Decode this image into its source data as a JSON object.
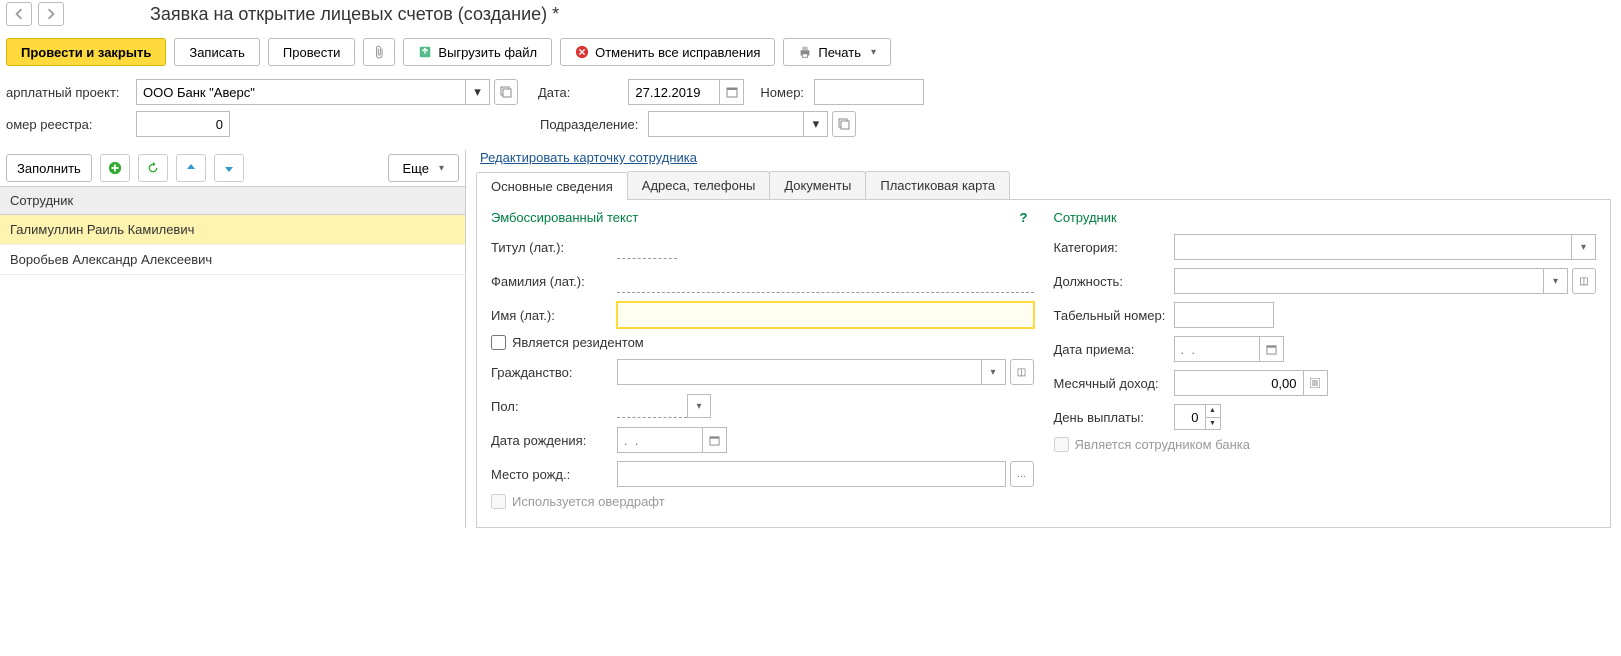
{
  "page_title": "Заявка на открытие лицевых счетов (создание) *",
  "toolbar": {
    "post_close": "Провести и закрыть",
    "save": "Записать",
    "post": "Провести",
    "upload": "Выгрузить файл",
    "cancel_fixes": "Отменить все исправления",
    "print": "Печать"
  },
  "header": {
    "project_label": "арплатный проект:",
    "project_value": "ООО Банк \"Аверс\"",
    "date_label": "Дата:",
    "date_value": "27.12.2019",
    "number_label": "Номер:",
    "number_value": "",
    "registry_label": "омер реестра:",
    "registry_value": "0",
    "dept_label": "Подразделение:",
    "dept_value": ""
  },
  "left": {
    "fill": "Заполнить",
    "more": "Еще",
    "col_header": "Сотрудник",
    "rows": [
      {
        "name": "Галимуллин Раиль Камилевич"
      },
      {
        "name": "Воробьев Александр Алексеевич"
      }
    ]
  },
  "right": {
    "edit_link": "Редактировать карточку сотрудника",
    "tabs": [
      {
        "label": "Основные сведения"
      },
      {
        "label": "Адреса, телефоны"
      },
      {
        "label": "Документы"
      },
      {
        "label": "Пластиковая карта"
      }
    ],
    "left_col": {
      "section": "Эмбоссированный текст",
      "title_label": "Титул (лат.):",
      "surname_label": "Фамилия (лат.):",
      "name_label": "Имя (лат.):",
      "resident_label": "Является резидентом",
      "citizenship_label": "Гражданство:",
      "gender_label": "Пол:",
      "birthdate_label": "Дата рождения:",
      "birthdate_placeholder": ".  .",
      "birthplace_label": "Место рожд.:",
      "overdraft_label": "Используется овердрафт"
    },
    "right_col": {
      "section": "Сотрудник",
      "category_label": "Категория:",
      "position_label": "Должность:",
      "tabnum_label": "Табельный номер:",
      "hiredate_label": "Дата приема:",
      "hiredate_placeholder": ".  .",
      "income_label": "Месячный доход:",
      "income_value": "0,00",
      "payday_label": "День выплаты:",
      "payday_value": "0",
      "bank_emp_label": "Является сотрудником банка"
    }
  }
}
